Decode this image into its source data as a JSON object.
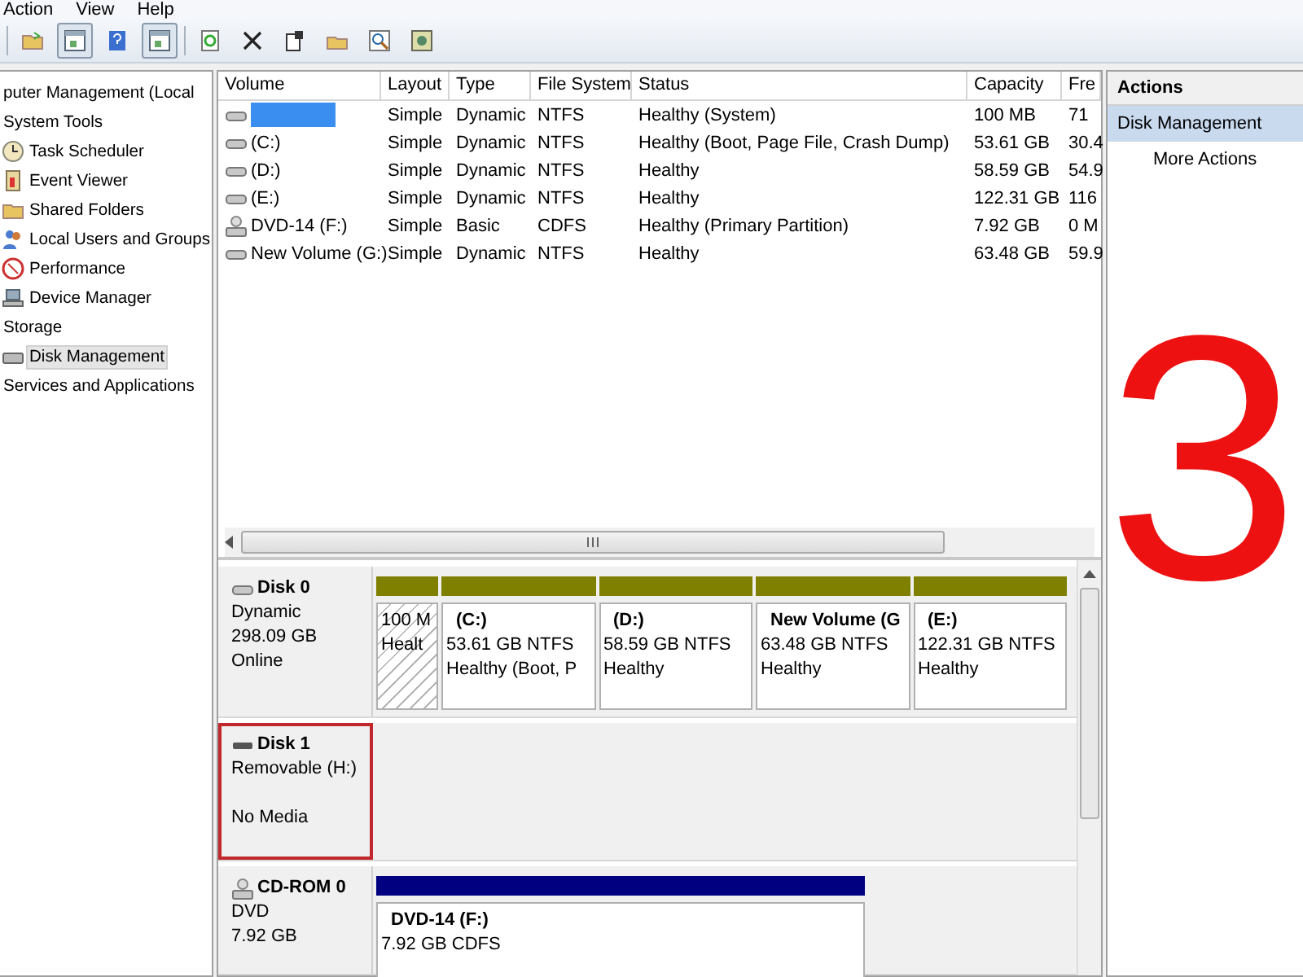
{
  "menu": [
    {
      "label": "Action"
    },
    {
      "label": "View"
    },
    {
      "label": "Help"
    }
  ],
  "tree": [
    {
      "label": "puter Management (Local",
      "selected": false,
      "children": [
        {
          "label": "System Tools",
          "selected": false,
          "children": [
            {
              "label": "Task Scheduler",
              "selected": false
            },
            {
              "label": "Event Viewer",
              "selected": false
            },
            {
              "label": "Shared Folders",
              "selected": false
            },
            {
              "label": "Local Users and Groups",
              "selected": false
            },
            {
              "label": "Performance",
              "selected": false
            },
            {
              "label": "Device Manager",
              "selected": false
            }
          ]
        },
        {
          "label": "Storage",
          "selected": false,
          "children": [
            {
              "label": "Disk Management",
              "selected": true
            }
          ]
        },
        {
          "label": "Services and Applications",
          "selected": false
        }
      ]
    }
  ],
  "volumes": {
    "columns": [
      "Volume",
      "Layout",
      "Type",
      "File System",
      "Status",
      "Capacity",
      "Fre"
    ],
    "rows": [
      {
        "kind": "disk",
        "name_hidden": true,
        "cells": [
          "",
          "Simple",
          "Dynamic",
          "NTFS",
          "Healthy (System)",
          "100 MB",
          "71"
        ]
      },
      {
        "kind": "disk",
        "name_hidden": false,
        "cells": [
          "(C:)",
          "Simple",
          "Dynamic",
          "NTFS",
          "Healthy (Boot, Page File, Crash Dump)",
          "53.61 GB",
          "30.4"
        ]
      },
      {
        "kind": "disk",
        "name_hidden": false,
        "cells": [
          "(D:)",
          "Simple",
          "Dynamic",
          "NTFS",
          "Healthy",
          "58.59 GB",
          "54.9"
        ]
      },
      {
        "kind": "disk",
        "name_hidden": false,
        "cells": [
          "(E:)",
          "Simple",
          "Dynamic",
          "NTFS",
          "Healthy",
          "122.31 GB",
          "116"
        ]
      },
      {
        "kind": "dvd",
        "name_hidden": false,
        "cells": [
          "DVD-14 (F:)",
          "Simple",
          "Basic",
          "CDFS",
          "Healthy (Primary Partition)",
          "7.92 GB",
          "0 M"
        ]
      },
      {
        "kind": "disk",
        "name_hidden": false,
        "cells": [
          "New Volume (G:)",
          "Simple",
          "Dynamic",
          "NTFS",
          "Healthy",
          "63.48 GB",
          "59.9"
        ]
      }
    ]
  },
  "disks": [
    {
      "kind": "disk",
      "name": "Disk 0",
      "type": "Dynamic",
      "size": "298.09 GB",
      "status": "Online",
      "highlighted": false,
      "partitions": [
        {
          "size": "100 M",
          "status": "Healt",
          "color": "#808000",
          "hatched": true
        },
        {
          "title": "(C:)",
          "size": "53.61 GB NTFS",
          "status": "Healthy (Boot, P",
          "color": "#808000",
          "hatched": false
        },
        {
          "title": "(D:)",
          "size": "58.59 GB NTFS",
          "status": "Healthy",
          "color": "#808000",
          "hatched": false
        },
        {
          "title": "New Volume  (G",
          "size": "63.48 GB NTFS",
          "status": "Healthy",
          "color": "#808000",
          "hatched": false
        },
        {
          "title": "(E:)",
          "size": "122.31 GB NTFS",
          "status": "Healthy",
          "color": "#808000",
          "hatched": false
        }
      ]
    },
    {
      "kind": "removable",
      "name": "Disk 1",
      "type": "Removable (H:)",
      "status": "No Media",
      "highlighted": true
    },
    {
      "kind": "dvd",
      "name": "CD-ROM 0",
      "type": "DVD",
      "size": "7.92 GB",
      "highlighted": false,
      "partitions": [
        {
          "title": "DVD-14  (F:)",
          "size": "7.92 GB CDFS",
          "color": "#000080",
          "hatched": false
        }
      ]
    }
  ],
  "actions": {
    "title": "Actions",
    "items": [
      {
        "label": "Disk Management",
        "kind": "header"
      },
      {
        "label": "More Actions",
        "kind": "link"
      }
    ]
  },
  "annotation": {
    "text": "3"
  }
}
